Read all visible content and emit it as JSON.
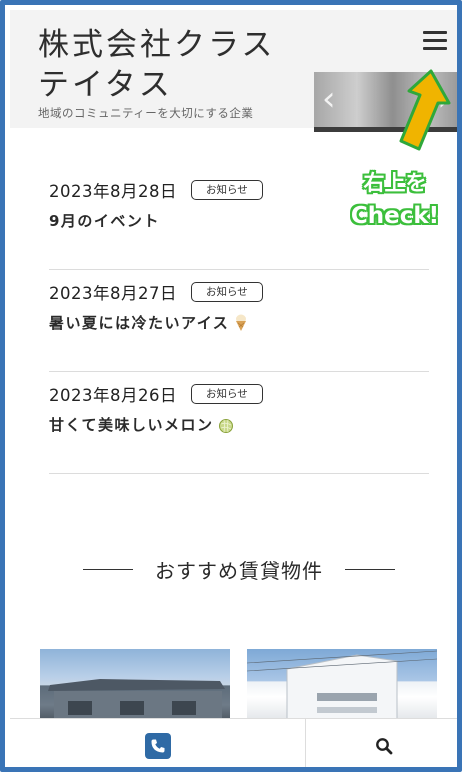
{
  "header": {
    "brand_name": "株式会社クラステイタス",
    "tagline": "地域のコミュニティーを大切にする企業",
    "slider_prev": "‹",
    "slider_next": "›"
  },
  "callout": {
    "line1": "右上を",
    "line2": "Check!",
    "arrow_color": "#f0b400",
    "text_outline_color": "#3cbf3c"
  },
  "news": {
    "items": [
      {
        "date": "2023年8月28日",
        "badge": "お知らせ",
        "title": "9月のイベント",
        "icon": ""
      },
      {
        "date": "2023年8月27日",
        "badge": "お知らせ",
        "title": "暑い夏には冷たいアイス",
        "icon": "ice-cream-icon"
      },
      {
        "date": "2023年8月26日",
        "badge": "お知らせ",
        "title": "甘くて美味しいメロン",
        "icon": "melon-icon"
      }
    ]
  },
  "featured": {
    "heading": "おすすめ賃貸物件"
  },
  "bottom_bar": {
    "phone_icon": "phone-icon",
    "search_icon": "search-icon"
  },
  "colors": {
    "frame": "#3a74b6",
    "phone_button": "#2f6aa5"
  }
}
